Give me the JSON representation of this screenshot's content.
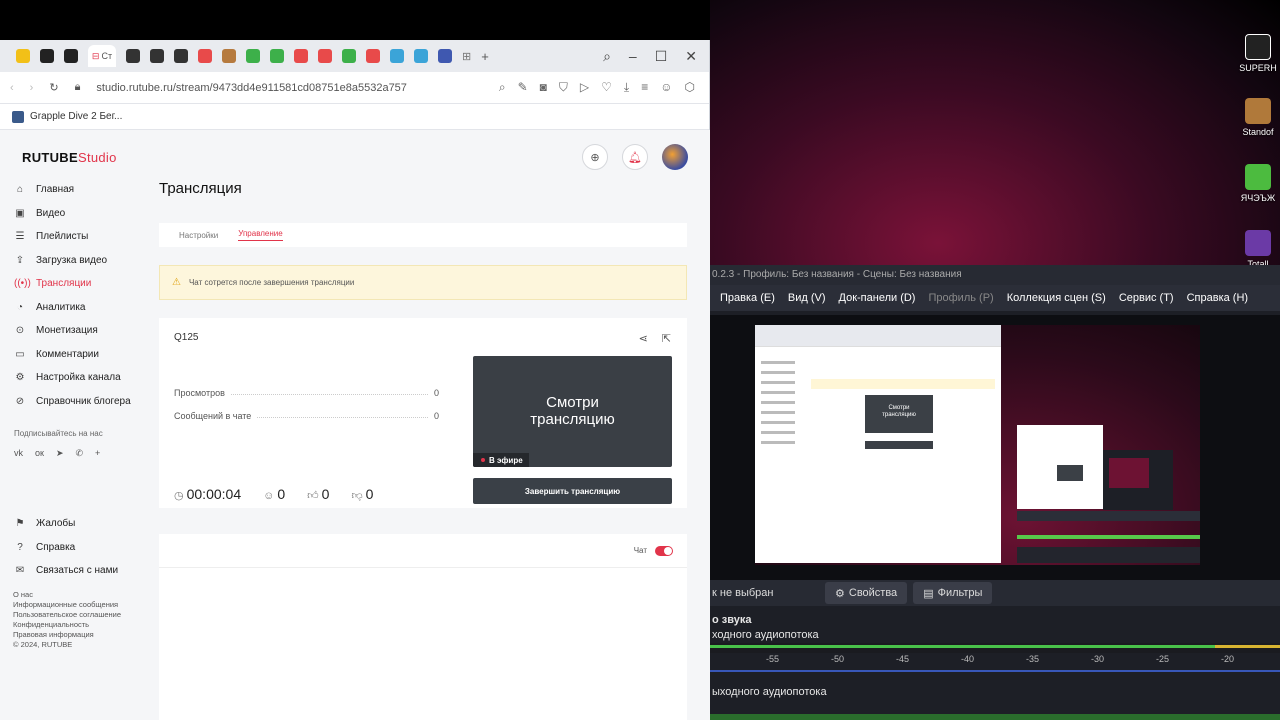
{
  "browser": {
    "active_tab_label": "Ст",
    "url": "studio.rutube.ru/stream/9473dd4e911581cd08751e8a5532a757",
    "bookmark": "Grapple Dive 2 Бег..."
  },
  "app": {
    "logo_main": "RUTUBE",
    "logo_sub": "Studio"
  },
  "sidebar": {
    "items": [
      {
        "label": "Главная",
        "icon": "home-icon"
      },
      {
        "label": "Видео",
        "icon": "video-icon"
      },
      {
        "label": "Плейлисты",
        "icon": "playlist-icon"
      },
      {
        "label": "Загрузка видео",
        "icon": "upload-icon"
      },
      {
        "label": "Трансляции",
        "icon": "broadcast-icon",
        "active": true
      },
      {
        "label": "Аналитика",
        "icon": "analytics-icon"
      },
      {
        "label": "Монетизация",
        "icon": "money-icon"
      },
      {
        "label": "Комментарии",
        "icon": "comments-icon"
      },
      {
        "label": "Настройка канала",
        "icon": "settings-icon"
      },
      {
        "label": "Справочник блогера",
        "icon": "book-icon"
      }
    ],
    "follow_label": "Подписывайтесь на нас",
    "bottom_items": [
      {
        "label": "Жалобы"
      },
      {
        "label": "Справка"
      },
      {
        "label": "Связаться с нами"
      }
    ],
    "footer": [
      "О нас",
      "Информационные сообщения",
      "Пользовательское соглашение",
      "Конфиденциальность",
      "Правовая информация",
      "© 2024, RUTUBE"
    ]
  },
  "main": {
    "title": "Трансляция",
    "tabs": [
      {
        "label": "Настройки"
      },
      {
        "label": "Управление",
        "active": true
      }
    ],
    "warning": "Чат сотрется после завершения трансляции",
    "stream_title": "Q125",
    "stats": [
      {
        "label": "Просмотров",
        "value": "0"
      },
      {
        "label": "Сообщений в чате",
        "value": "0"
      }
    ],
    "preview_text_1": "Смотри",
    "preview_text_2": "трансляцию",
    "live_badge": "В эфире",
    "duration": "00:00:04",
    "viewers": "0",
    "likes": "0",
    "dislikes": "0",
    "end_button": "Завершить трансляцию",
    "chat_label": "Чат"
  },
  "obs": {
    "title": "0.2.3 - Профиль: Без названия - Сцены: Без названия",
    "menu": [
      "Правка (E)",
      "Вид (V)",
      "Док-панели (D)",
      "Профиль (P)",
      "Коллекция сцен (S)",
      "Сервис (T)",
      "Справка (H)"
    ],
    "source_label": "к не выбран",
    "properties_button": "Свойства",
    "filters_button": "Фильтры",
    "mixer_title": "о звука",
    "track1": "ходного аудиопотока",
    "track2": "ыходного аудиопотока",
    "scale": [
      "-55",
      "-50",
      "-45",
      "-40",
      "-35",
      "-30",
      "-25",
      "-20"
    ]
  },
  "desktop": {
    "icons": [
      "SUPERH",
      "Standof",
      "ЯЧЭЪЖ",
      "Totall"
    ]
  },
  "colors": {
    "accent": "#e1344a",
    "obs_bg": "#1d1f26"
  }
}
